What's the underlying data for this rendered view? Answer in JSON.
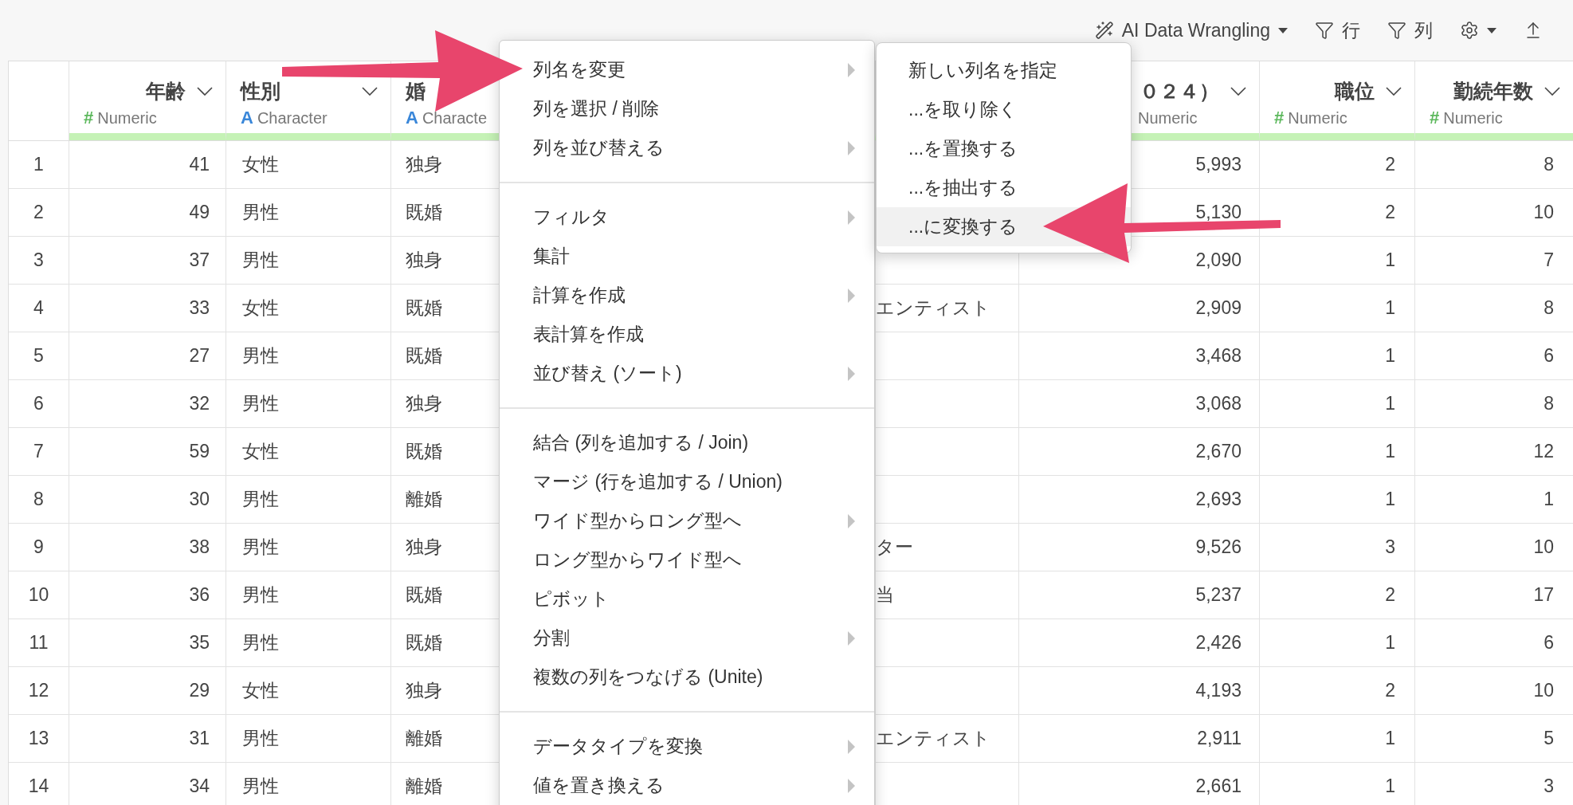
{
  "toolbar": {
    "ai_button": "AI Data Wrangling",
    "row_filter": "行",
    "column_filter": "列"
  },
  "table": {
    "columns": [
      {
        "label": "年齢",
        "type": "Numeric",
        "type_icon": "#",
        "kind": "numeric"
      },
      {
        "label": "性別",
        "type": "Character",
        "type_icon": "A",
        "kind": "character"
      },
      {
        "label": "婚",
        "type": "Characte",
        "type_icon": "A",
        "kind": "character"
      },
      {
        "label": "０２４）",
        "type": "Numeric",
        "kind": "numeric"
      },
      {
        "label": "職位",
        "type": "Numeric",
        "type_icon": "#",
        "kind": "numeric"
      },
      {
        "label": "勤続年数",
        "type": "Numeric",
        "type_icon": "#",
        "kind": "numeric"
      }
    ],
    "rows": [
      {
        "number": "1",
        "age": "41",
        "sex": "女性",
        "marital": "独身",
        "salary": "5,993",
        "rank": "2",
        "years": "8"
      },
      {
        "number": "2",
        "age": "49",
        "sex": "男性",
        "marital": "既婚",
        "salary": "5,130",
        "rank": "2",
        "years": "10"
      },
      {
        "number": "3",
        "age": "37",
        "sex": "男性",
        "marital": "独身",
        "salary": "2,090",
        "rank": "1",
        "years": "7"
      },
      {
        "number": "4",
        "age": "33",
        "sex": "女性",
        "marital": "既婚",
        "column_5": "エンティスト",
        "salary": "2,909",
        "rank": "1",
        "years": "8"
      },
      {
        "number": "5",
        "age": "27",
        "sex": "男性",
        "marital": "既婚",
        "salary": "3,468",
        "rank": "1",
        "years": "6"
      },
      {
        "number": "6",
        "age": "32",
        "sex": "男性",
        "marital": "独身",
        "salary": "3,068",
        "rank": "1",
        "years": "8"
      },
      {
        "number": "7",
        "age": "59",
        "sex": "女性",
        "marital": "既婚",
        "salary": "2,670",
        "rank": "1",
        "years": "12"
      },
      {
        "number": "8",
        "age": "30",
        "sex": "男性",
        "marital": "離婚",
        "salary": "2,693",
        "rank": "1",
        "years": "1"
      },
      {
        "number": "9",
        "age": "38",
        "sex": "男性",
        "marital": "独身",
        "column_5": "ター",
        "salary": "9,526",
        "rank": "3",
        "years": "10"
      },
      {
        "number": "10",
        "age": "36",
        "sex": "男性",
        "marital": "既婚",
        "column_5": "当",
        "salary": "5,237",
        "rank": "2",
        "years": "17"
      },
      {
        "number": "11",
        "age": "35",
        "sex": "男性",
        "marital": "既婚",
        "salary": "2,426",
        "rank": "1",
        "years": "6"
      },
      {
        "number": "12",
        "age": "29",
        "sex": "女性",
        "marital": "独身",
        "salary": "4,193",
        "rank": "2",
        "years": "10"
      },
      {
        "number": "13",
        "age": "31",
        "sex": "男性",
        "marital": "離婚",
        "column_5": "エンティスト",
        "salary": "2,911",
        "rank": "1",
        "years": "5"
      },
      {
        "number": "14",
        "age": "34",
        "sex": "男性",
        "marital": "離婚",
        "salary": "2,661",
        "rank": "1",
        "years": "3"
      }
    ]
  },
  "context_menu": {
    "groups": [
      [
        {
          "label": "列名を変更",
          "submenu": true
        },
        {
          "label": "列を選択 / 削除",
          "submenu": false
        },
        {
          "label": "列を並び替える",
          "submenu": true
        }
      ],
      [
        {
          "label": "フィルタ",
          "submenu": true
        },
        {
          "label": "集計",
          "submenu": false
        },
        {
          "label": "計算を作成",
          "submenu": true
        },
        {
          "label": "表計算を作成",
          "submenu": false
        },
        {
          "label": "並び替え (ソート)",
          "submenu": true
        }
      ],
      [
        {
          "label": "結合 (列を追加する / Join)",
          "submenu": false
        },
        {
          "label": "マージ (行を追加する / Union)",
          "submenu": false
        },
        {
          "label": "ワイド型からロング型へ",
          "submenu": true
        },
        {
          "label": "ロング型からワイド型へ",
          "submenu": false
        },
        {
          "label": "ピボット",
          "submenu": false
        },
        {
          "label": "分割",
          "submenu": true
        },
        {
          "label": "複数の列をつなげる (Unite)",
          "submenu": false
        }
      ],
      [
        {
          "label": "データタイプを変換",
          "submenu": true
        },
        {
          "label": "値を置き換える",
          "submenu": true
        }
      ]
    ]
  },
  "submenu": {
    "items": [
      {
        "label": "新しい列名を指定",
        "selected": false
      },
      {
        "label": "...を取り除く",
        "selected": false
      },
      {
        "label": "...を置換する",
        "selected": false
      },
      {
        "label": "...を抽出する",
        "selected": false
      },
      {
        "label": "...に変換する",
        "selected": true
      }
    ]
  }
}
